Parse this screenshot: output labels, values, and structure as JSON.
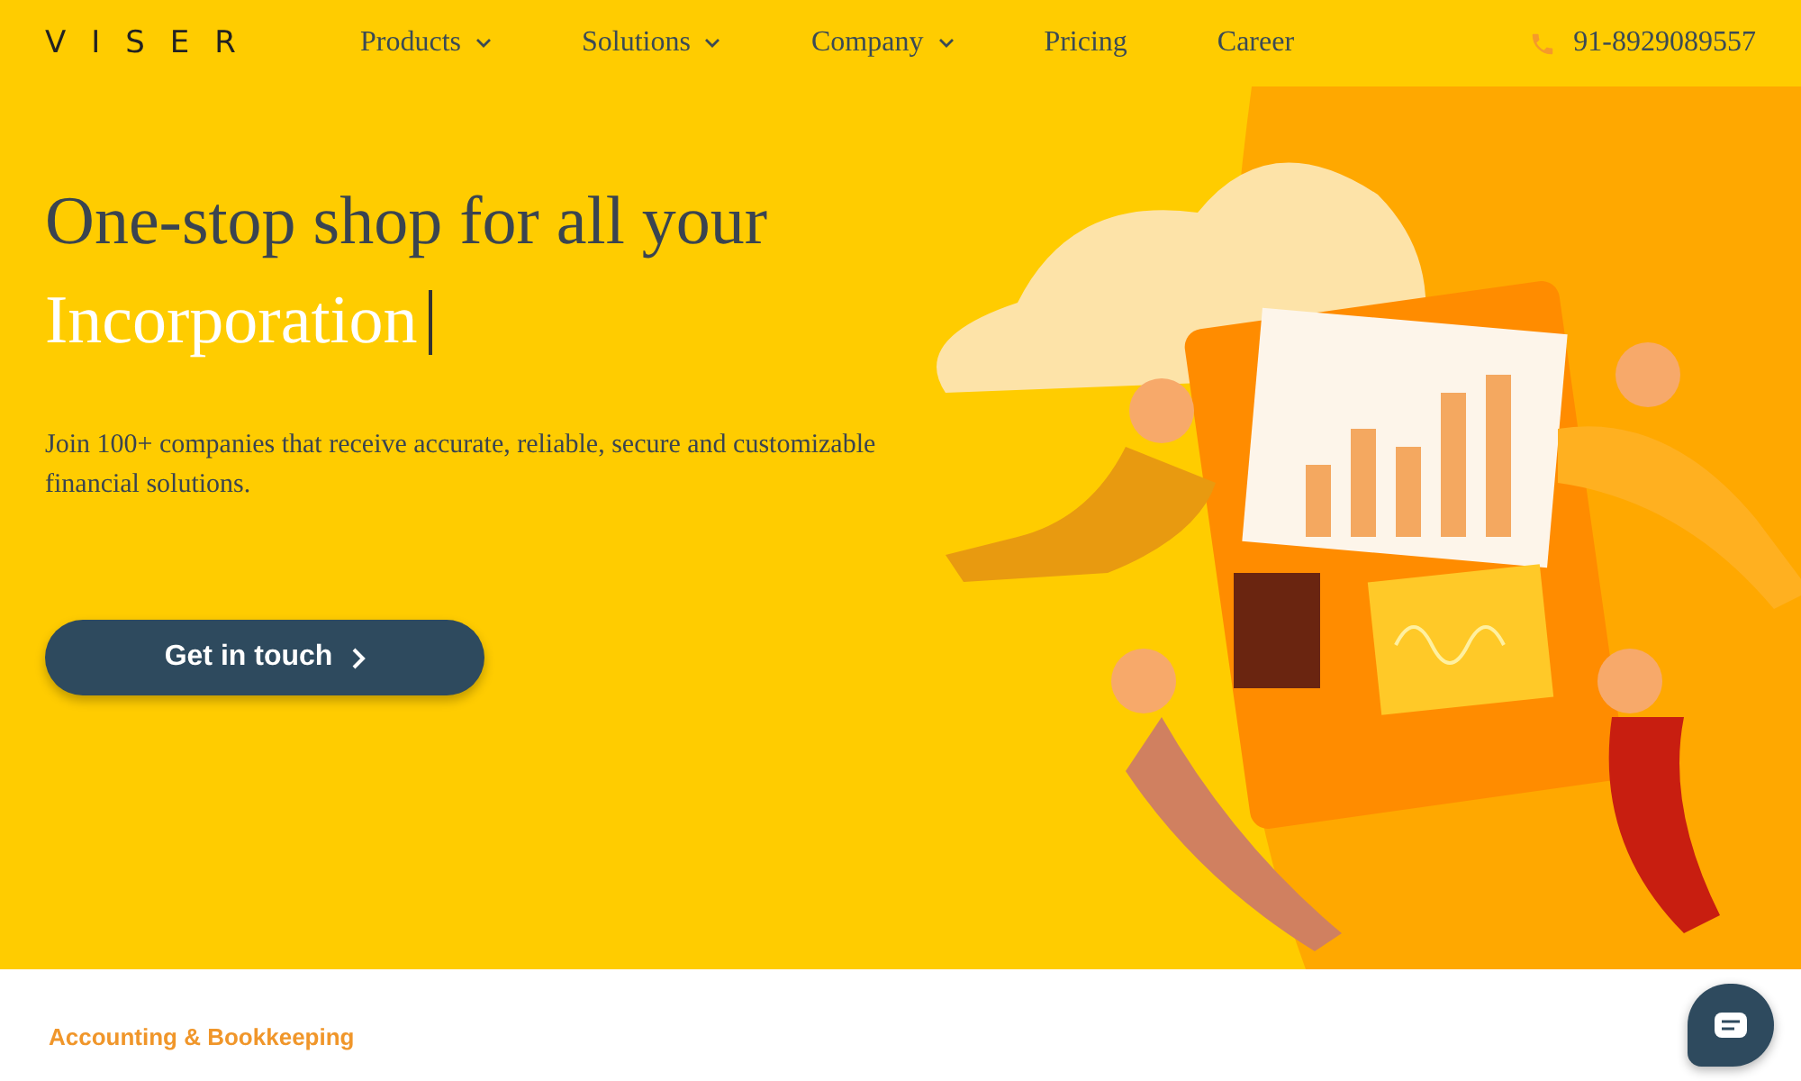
{
  "logo": {
    "text": "VISER"
  },
  "nav": [
    {
      "label": "Products",
      "dropdown": true
    },
    {
      "label": "Solutions",
      "dropdown": true
    },
    {
      "label": "Company",
      "dropdown": true
    },
    {
      "label": "Pricing",
      "dropdown": false
    },
    {
      "label": "Career",
      "dropdown": false
    }
  ],
  "phone": "91-8929089557",
  "hero": {
    "title_line_1": "One-stop shop for all your",
    "title_line_2": "Incorporation",
    "subtitle": "Join 100+ companies that receive accurate, reliable, secure and customizable financial solutions.",
    "button": "Get in touch"
  },
  "section": {
    "label": "Accounting & Bookkeeping"
  }
}
